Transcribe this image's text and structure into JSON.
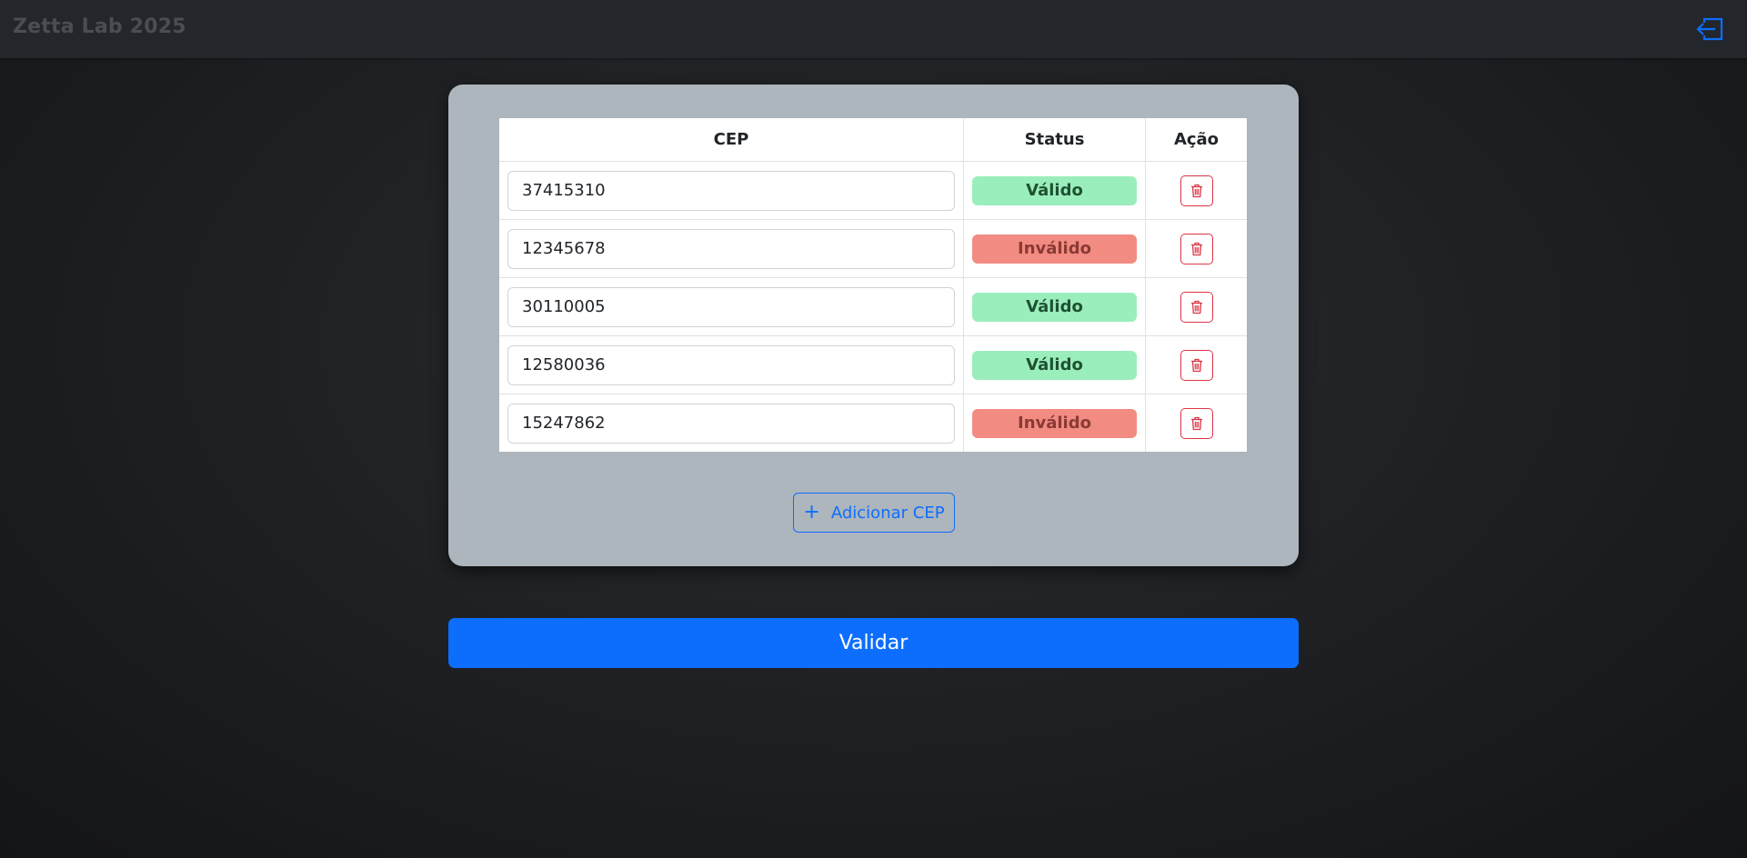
{
  "app": {
    "title": "Zetta Lab 2025",
    "logout_icon": "box-arrow-in-left-icon"
  },
  "table": {
    "headers": [
      "CEP",
      "Status",
      "Ação"
    ],
    "rows": [
      {
        "cep": "37415310",
        "status": "Válido",
        "status_type": "valid"
      },
      {
        "cep": "12345678",
        "status": "Inválido",
        "status_type": "invalid"
      },
      {
        "cep": "30110005",
        "status": "Válido",
        "status_type": "valid"
      },
      {
        "cep": "12580036",
        "status": "Válido",
        "status_type": "valid"
      },
      {
        "cep": "15247862",
        "status": "Inválido",
        "status_type": "invalid"
      }
    ],
    "delete_icon": "trash-icon"
  },
  "actions": {
    "add_label": "Adicionar CEP",
    "add_icon": "plus-icon",
    "validate_label": "Validar"
  },
  "colors": {
    "primary": "#0d6efd",
    "danger": "#dc3545",
    "valid_bg": "#9aeebb",
    "invalid_bg": "#f28b82",
    "card_bg": "#adb5bd",
    "navbar_bg": "#23262b"
  }
}
